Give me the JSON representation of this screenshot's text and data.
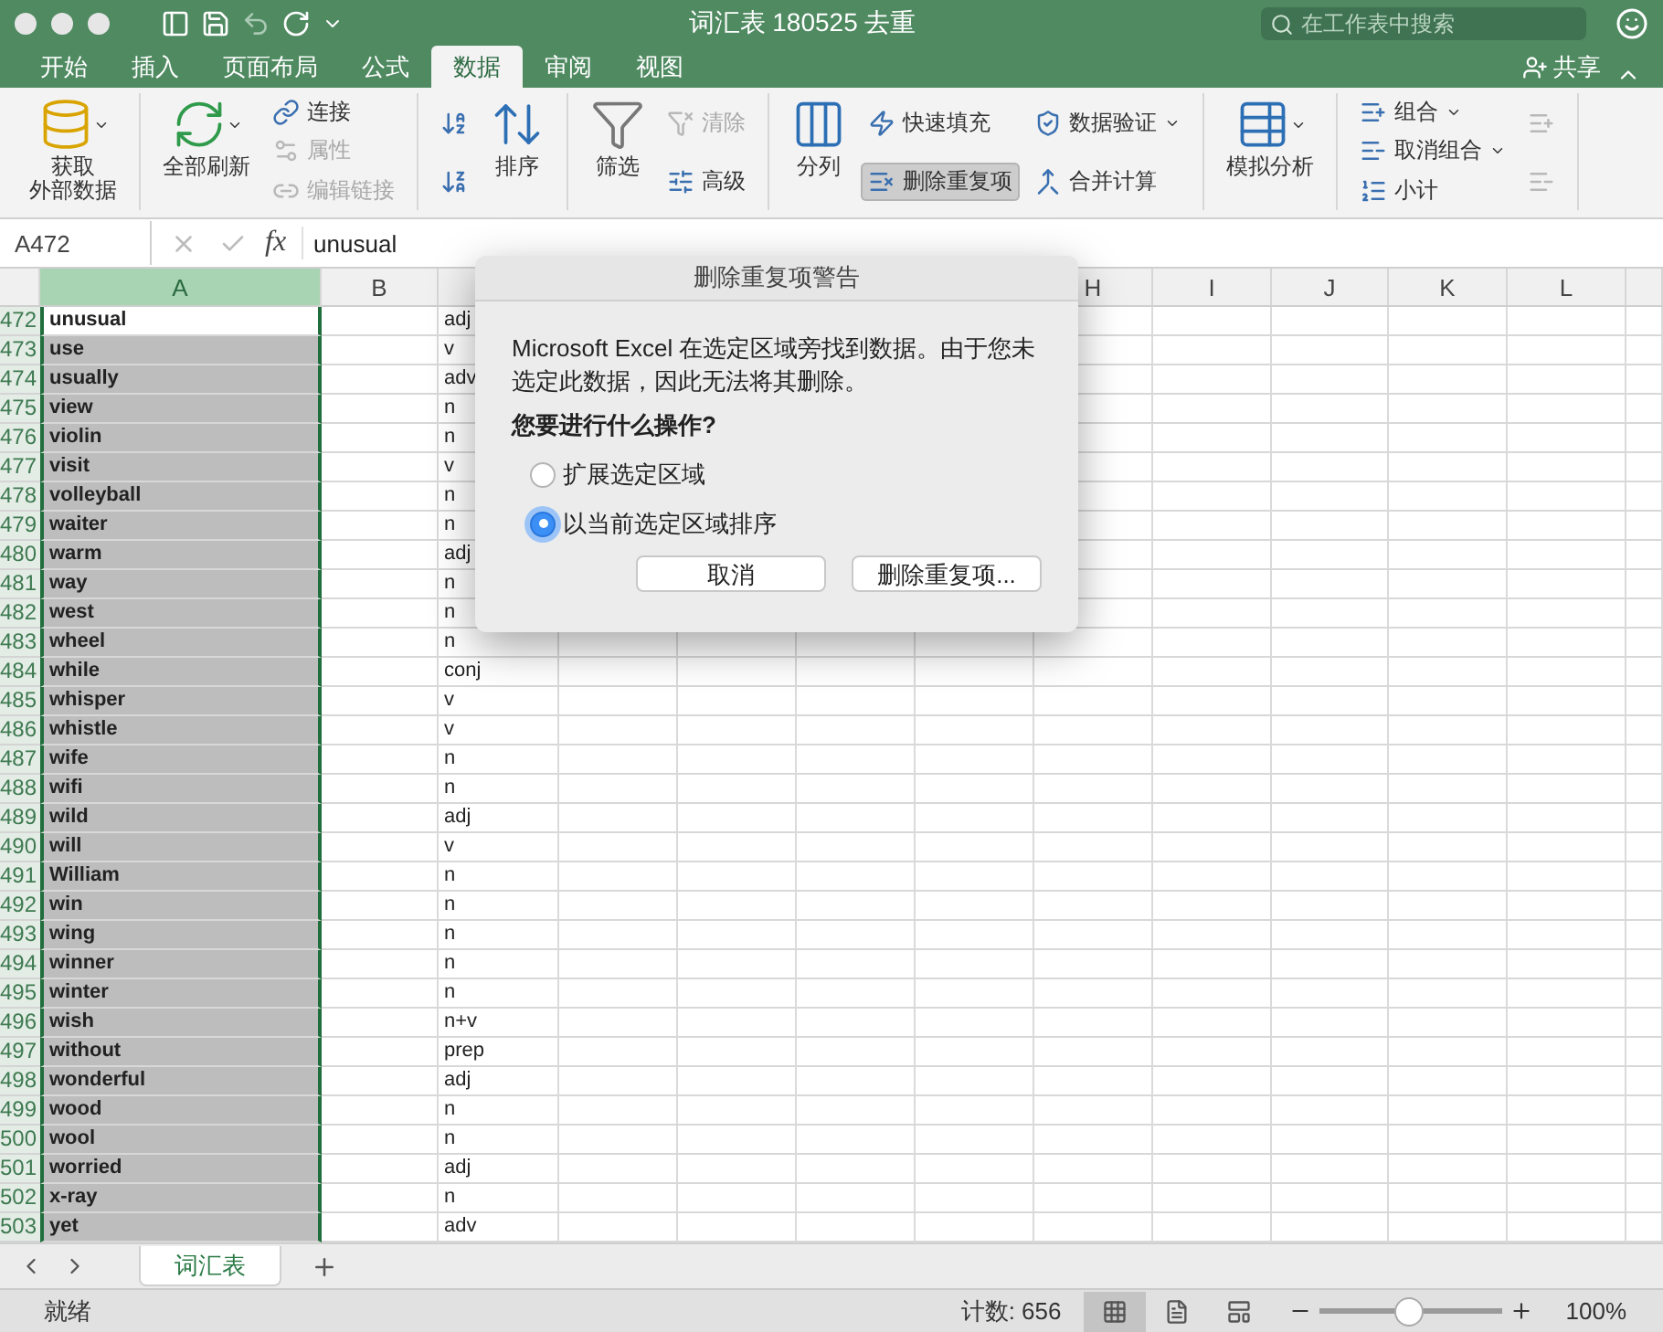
{
  "window": {
    "title": "词汇表 180525 去重"
  },
  "search": {
    "placeholder": "在工作表中搜索"
  },
  "tabs": [
    {
      "label": "开始",
      "selected": false
    },
    {
      "label": "插入",
      "selected": false
    },
    {
      "label": "页面布局",
      "selected": false
    },
    {
      "label": "公式",
      "selected": false
    },
    {
      "label": "数据",
      "selected": true
    },
    {
      "label": "审阅",
      "selected": false
    },
    {
      "label": "视图",
      "selected": false
    }
  ],
  "share": {
    "label": "共享"
  },
  "ribbon": {
    "groups": [
      {
        "columns": [
          {
            "kind": "large",
            "lines": [
              "获取",
              "外部数据"
            ],
            "dropdown": true,
            "disabled": false,
            "pressed": false
          }
        ]
      },
      {
        "columns": [
          {
            "kind": "large",
            "label": "全部刷新",
            "dropdown": true,
            "disabled": false,
            "pressed": false
          },
          {
            "kind": "stack",
            "items": [
              {
                "label": "连接",
                "dropdown": false,
                "disabled": false,
                "pressed": false
              },
              {
                "label": "属性",
                "dropdown": false,
                "disabled": true,
                "pressed": false
              },
              {
                "label": "编辑链接",
                "dropdown": false,
                "disabled": true,
                "pressed": false
              }
            ]
          }
        ]
      },
      {
        "columns": [
          {
            "kind": "stack",
            "items": [
              {
                "dropdown": false,
                "disabled": false,
                "pressed": false
              },
              {
                "dropdown": false,
                "disabled": false,
                "pressed": false
              }
            ]
          },
          {
            "kind": "large",
            "label": "排序",
            "dropdown": false,
            "disabled": false,
            "pressed": false
          }
        ]
      },
      {
        "columns": [
          {
            "kind": "large",
            "label": "筛选",
            "dropdown": false,
            "disabled": false,
            "pressed": false
          },
          {
            "kind": "stack",
            "items": [
              {
                "label": "清除",
                "dropdown": false,
                "disabled": true,
                "pressed": false
              },
              {
                "label": "高级",
                "dropdown": false,
                "disabled": false,
                "pressed": false
              }
            ]
          }
        ]
      },
      {
        "columns": [
          {
            "kind": "large",
            "label": "分列",
            "dropdown": false,
            "disabled": false,
            "pressed": false
          },
          {
            "kind": "stack",
            "items": [
              {
                "label": "快速填充",
                "dropdown": false,
                "disabled": false,
                "pressed": false
              },
              {
                "label": "删除重复项",
                "dropdown": false,
                "disabled": false,
                "pressed": true
              }
            ]
          },
          {
            "kind": "stack",
            "items": [
              {
                "label": "数据验证",
                "dropdown": true,
                "disabled": false,
                "pressed": false
              },
              {
                "label": "合并计算",
                "dropdown": false,
                "disabled": false,
                "pressed": false
              }
            ]
          }
        ]
      },
      {
        "columns": [
          {
            "kind": "large",
            "label": "模拟分析",
            "dropdown": true,
            "disabled": false,
            "pressed": false
          }
        ]
      },
      {
        "columns": [
          {
            "kind": "stack",
            "items": [
              {
                "label": "组合",
                "dropdown": true,
                "disabled": false,
                "pressed": false
              },
              {
                "label": "取消组合",
                "dropdown": true,
                "disabled": false,
                "pressed": false
              },
              {
                "label": "小计",
                "dropdown": false,
                "disabled": false,
                "pressed": false
              }
            ]
          },
          {
            "kind": "stack",
            "items": [
              {
                "dropdown": false,
                "disabled": true,
                "pressed": false
              },
              {
                "dropdown": false,
                "disabled": true,
                "pressed": false
              }
            ]
          }
        ]
      }
    ]
  },
  "formula_bar": {
    "name_box": "A472",
    "function_label": "fx",
    "content": "unusual"
  },
  "sheet": {
    "column_headers": [
      {
        "label": "A",
        "selected": true
      },
      {
        "label": "B",
        "selected": false
      },
      {
        "label": "H",
        "selected": false
      },
      {
        "label": "I",
        "selected": false
      },
      {
        "label": "J",
        "selected": false
      },
      {
        "label": "K",
        "selected": false
      },
      {
        "label": "L",
        "selected": false
      }
    ],
    "rows": [
      {
        "number": "472",
        "word": "unusual",
        "pos": "adj",
        "active": true
      },
      {
        "number": "473",
        "word": "use",
        "pos": "v",
        "active": false
      },
      {
        "number": "474",
        "word": "usually",
        "pos": "adv",
        "active": false
      },
      {
        "number": "475",
        "word": "view",
        "pos": "n",
        "active": false
      },
      {
        "number": "476",
        "word": "violin",
        "pos": "n",
        "active": false
      },
      {
        "number": "477",
        "word": "visit",
        "pos": "v",
        "active": false
      },
      {
        "number": "478",
        "word": "volleyball",
        "pos": "n",
        "active": false
      },
      {
        "number": "479",
        "word": "waiter",
        "pos": "n",
        "active": false
      },
      {
        "number": "480",
        "word": "warm",
        "pos": "adj",
        "active": false
      },
      {
        "number": "481",
        "word": "way",
        "pos": "n",
        "active": false
      },
      {
        "number": "482",
        "word": "west",
        "pos": "n",
        "active": false
      },
      {
        "number": "483",
        "word": "wheel",
        "pos": "n",
        "active": false
      },
      {
        "number": "484",
        "word": "while",
        "pos": "conj",
        "active": false
      },
      {
        "number": "485",
        "word": "whisper",
        "pos": "v",
        "active": false
      },
      {
        "number": "486",
        "word": "whistle",
        "pos": "v",
        "active": false
      },
      {
        "number": "487",
        "word": "wife",
        "pos": "n",
        "active": false
      },
      {
        "number": "488",
        "word": "wifi",
        "pos": "n",
        "active": false
      },
      {
        "number": "489",
        "word": "wild",
        "pos": "adj",
        "active": false
      },
      {
        "number": "490",
        "word": "will",
        "pos": "v",
        "active": false
      },
      {
        "number": "491",
        "word": "William",
        "pos": "n",
        "active": false
      },
      {
        "number": "492",
        "word": "win",
        "pos": "n",
        "active": false
      },
      {
        "number": "493",
        "word": "wing",
        "pos": "n",
        "active": false
      },
      {
        "number": "494",
        "word": "winner",
        "pos": "n",
        "active": false
      },
      {
        "number": "495",
        "word": "winter",
        "pos": "n",
        "active": false
      },
      {
        "number": "496",
        "word": "wish",
        "pos": "n+v",
        "active": false
      },
      {
        "number": "497",
        "word": "without",
        "pos": "prep",
        "active": false
      },
      {
        "number": "498",
        "word": "wonderful",
        "pos": "adj",
        "active": false
      },
      {
        "number": "499",
        "word": "wood",
        "pos": "n",
        "active": false
      },
      {
        "number": "500",
        "word": "wool",
        "pos": "n",
        "active": false
      },
      {
        "number": "501",
        "word": "worried",
        "pos": "adj",
        "active": false
      },
      {
        "number": "502",
        "word": "x-ray",
        "pos": "n",
        "active": false
      },
      {
        "number": "503",
        "word": "yet",
        "pos": "adv",
        "active": false
      }
    ]
  },
  "dialog": {
    "title": "删除重复项警告",
    "message": "Microsoft Excel 在选定区域旁找到数据。由于您未选定此数据，因此无法将其删除。",
    "question": "您要进行什么操作?",
    "options": [
      {
        "label": "扩展选定区域",
        "selected": false
      },
      {
        "label": "以当前选定区域排序",
        "selected": true
      }
    ],
    "buttons": [
      "取消",
      "删除重复项..."
    ]
  },
  "sheet_tabs": [
    {
      "label": "词汇表",
      "selected": true
    }
  ],
  "status_bar": {
    "status": "就绪",
    "count": "计数: 656",
    "views": [
      {
        "selected": true
      },
      {
        "selected": false
      },
      {
        "selected": false
      }
    ],
    "zoom": {
      "level": 0.49,
      "reading": "100%"
    }
  }
}
